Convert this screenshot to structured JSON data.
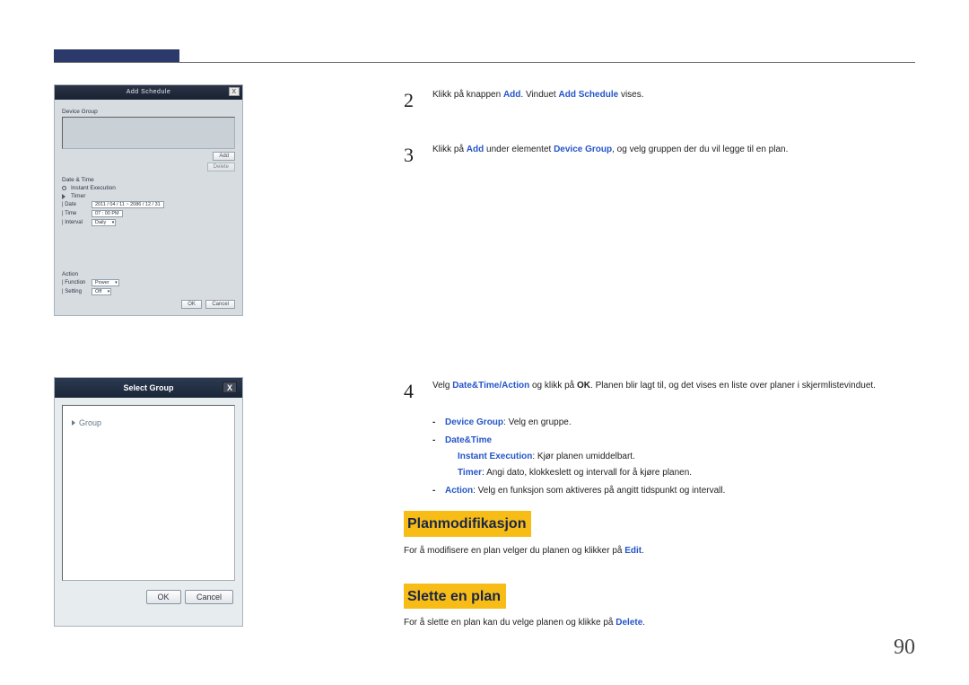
{
  "page_number": "90",
  "screenshot1": {
    "title": "Add Schedule",
    "close": "X",
    "device_group_label": "Device Group",
    "add_btn": "Add",
    "delete_btn": "Delete",
    "datetime_label": "Date & Time",
    "instant_label": "Instant Execution",
    "timer_label": "Timer",
    "date_label": "| Date",
    "date_values": "2011  /  04  /  11   ~  2086  /  12  /  31",
    "time_label": "| Time",
    "time_values": "07  :  00     PM",
    "interval_label": "| Interval",
    "interval_value": "Daily",
    "action_label": "Action",
    "function_label": "| Function",
    "function_value": "Power",
    "setting_label": "| Setting",
    "setting_value": "Off",
    "ok": "OK",
    "cancel": "Cancel"
  },
  "screenshot2": {
    "title": "Select Group",
    "close": "X",
    "tree_root": "Group",
    "ok": "OK",
    "cancel": "Cancel"
  },
  "steps": {
    "s2": {
      "num": "2",
      "pre": "Klikk på knappen ",
      "term1": "Add",
      "mid": ". Vinduet ",
      "term2": "Add Schedule",
      "post": " vises."
    },
    "s3": {
      "num": "3",
      "pre": "Klikk på ",
      "term1": "Add",
      "mid": " under elementet ",
      "term2": "Device Group",
      "post": ", og velg gruppen der du vil legge til en plan."
    },
    "s4": {
      "num": "4",
      "pre": "Velg ",
      "term1": "Date&Time",
      "slash": "/",
      "term2": "Action",
      "mid": " og klikk på ",
      "ok": "OK",
      "post": ". Planen blir lagt til, og det vises en liste over planer i skjermlistevinduet."
    }
  },
  "sublist": {
    "dg_term": "Device Group",
    "dg_post": ": Velg en gruppe.",
    "dt_term": "Date&Time",
    "ie_term": "Instant Execution",
    "ie_post": ": Kjør planen umiddelbart.",
    "tm_term": "Timer",
    "tm_post": ": Angi dato, klokkeslett og intervall for å kjøre planen.",
    "ac_term": "Action",
    "ac_post": ": Velg en funksjon som aktiveres på angitt tidspunkt og intervall."
  },
  "headings": {
    "modify": "Planmodifikasjon",
    "delete": "Slette en plan"
  },
  "paras": {
    "modify_pre": "For å modifisere en plan velger du planen og klikker på ",
    "modify_term": "Edit",
    "modify_post": ".",
    "delete_pre": "For å slette en plan kan du velge planen og klikke på ",
    "delete_term": "Delete",
    "delete_post": "."
  }
}
